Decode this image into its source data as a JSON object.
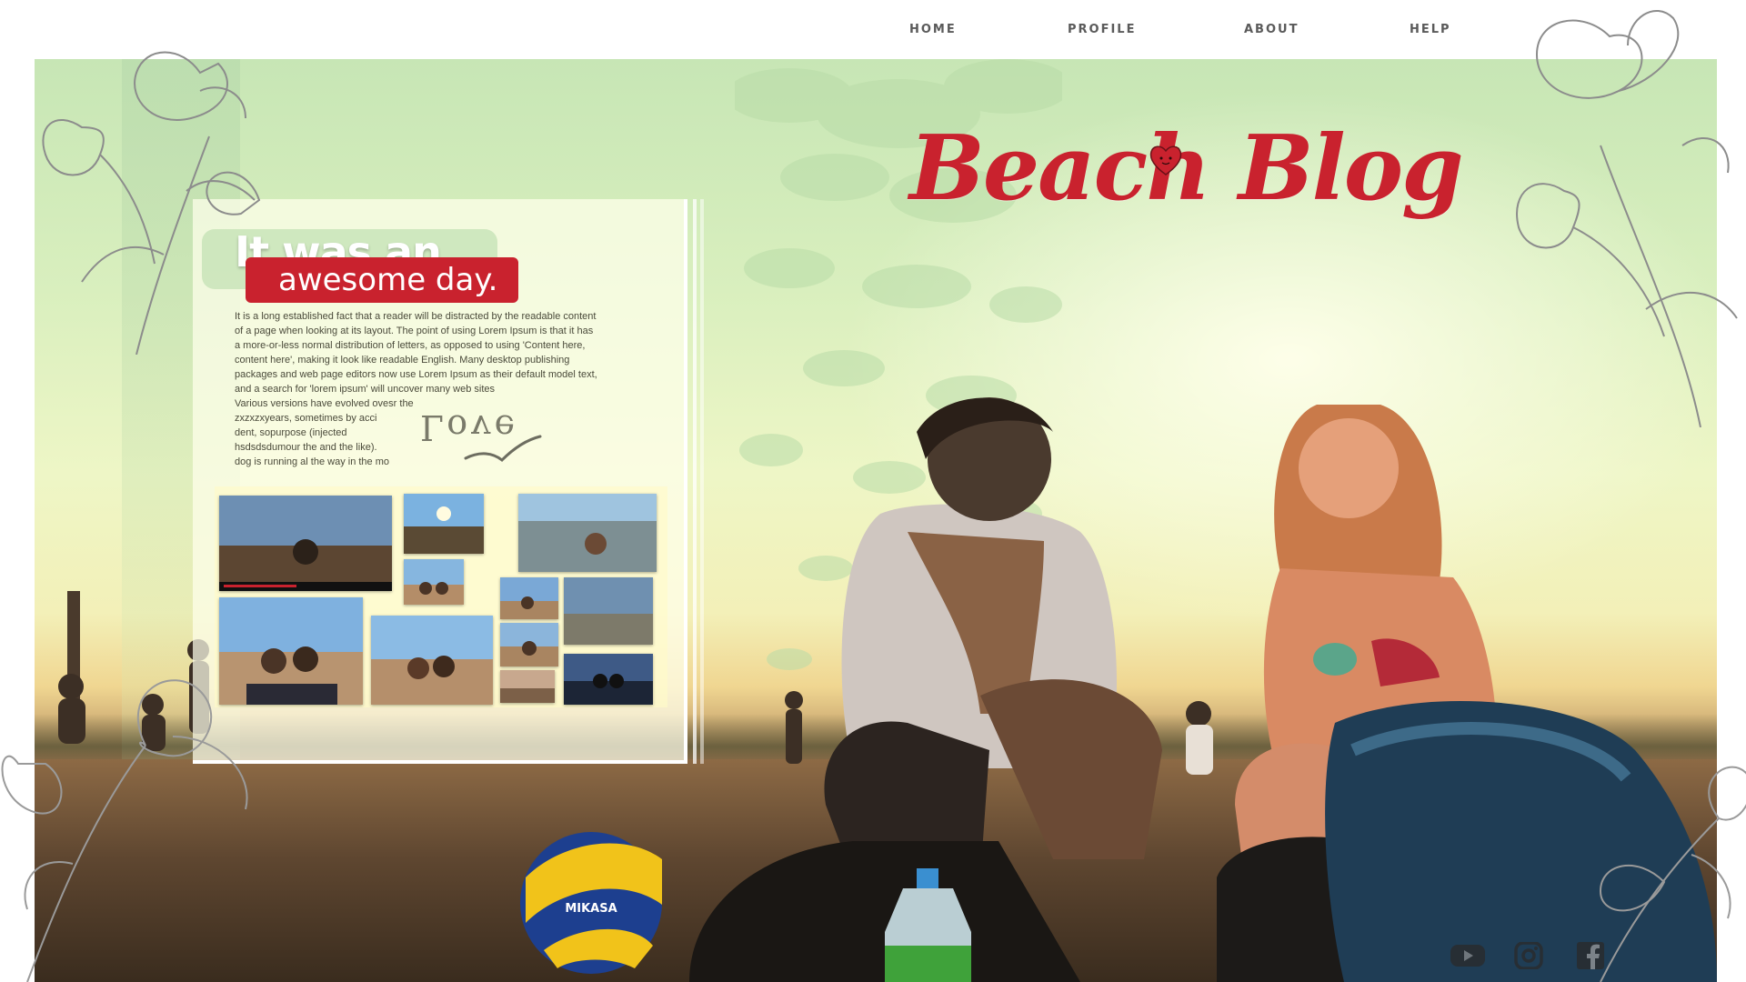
{
  "nav": {
    "items": [
      {
        "label": "HOME"
      },
      {
        "label": "PROFILE"
      },
      {
        "label": "ABOUT"
      },
      {
        "label": "HELP"
      }
    ]
  },
  "hero": {
    "title": "Beach Blog",
    "heart_icon": "heart-icon",
    "ball_text": "MIKASA"
  },
  "story": {
    "headline_line1": "It was an",
    "headline_line2": "awesome day.",
    "body_lines": [
      "It is a long established fact that a reader will be distracted by the readable content",
      "of a page when looking at its layout. The point of using Lorem Ipsum is that it has",
      "a more-or-less normal distribution of letters, as opposed to using 'Content here,",
      "content here', making it look like readable English. Many desktop publishing",
      "packages and web page editors now use Lorem Ipsum as their default model text,",
      "and a search for 'lorem ipsum' will uncover many web sites",
      " Various versions have evolved   ovesr the",
      " zxzxzxyears, sometimes by acci",
      "dent, sopurpose (injected",
      "hsdsdsdumour  the and the like).",
      "dog is running al the way in the mo"
    ],
    "love_word": "Love",
    "bird_icon": "bird-icon"
  },
  "social": [
    "youtube-icon",
    "instagram-icon",
    "facebook-icon"
  ],
  "colors": {
    "accent": "#c9222e",
    "nav_text": "#5a5a5a"
  }
}
